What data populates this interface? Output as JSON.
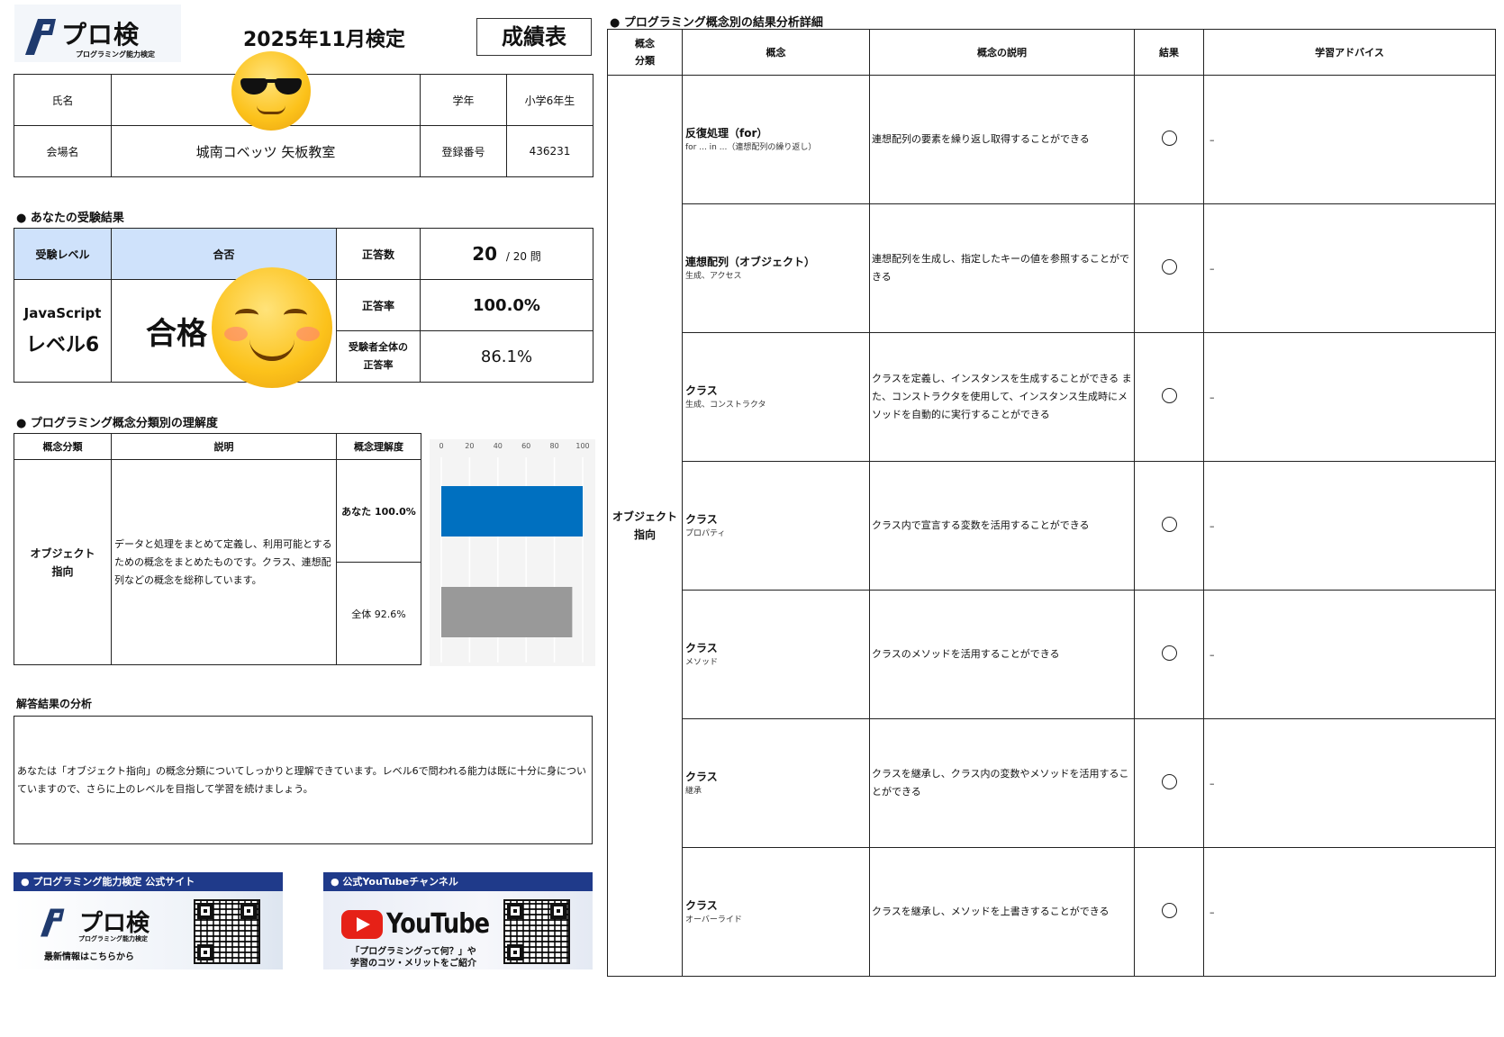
{
  "header": {
    "logo_text": "プロ検",
    "logo_sub": "プログラミング能力検定",
    "exam_title": "2025年11月検定",
    "report_title": "成績表"
  },
  "info": {
    "name_label": "氏名",
    "name_value": "",
    "grade_label": "学年",
    "grade_value": "小学6年生",
    "venue_label": "会場名",
    "venue_value": "城南コベッツ 矢板教室",
    "reg_label": "登録番号",
    "reg_value": "436231"
  },
  "result": {
    "section_title": "● あなたの受験結果",
    "level_header": "受験レベル",
    "pass_header": "合否",
    "correct_label": "正答数",
    "correct_value": "20",
    "correct_total": "/ 20 問",
    "level_line1": "JavaScript",
    "level_line2": "レベル6",
    "pass_value": "合格",
    "rate_label": "正答率",
    "rate_value": "100.0%",
    "overall_label_1": "受験者全体の",
    "overall_label_2": "正答率",
    "overall_value": "86.1%"
  },
  "understanding": {
    "section_title": "● プログラミング概念分類別の理解度",
    "col_category": "概念分類",
    "col_desc": "説明",
    "col_level": "概念理解度",
    "category_line1": "オブジェクト",
    "category_line2": "指向",
    "description": "データと処理をまとめて定義し、利用可能とするための概念をまとめたものです。クラス、連想配列などの概念を総称しています。",
    "you_label": "あなた 100.0%",
    "all_label": "全体 92.6%"
  },
  "chart_data": {
    "type": "bar",
    "orientation": "horizontal",
    "categories": [
      "あなた",
      "全体"
    ],
    "values": [
      100.0,
      92.6
    ],
    "colors": [
      "#0070c0",
      "#999999"
    ],
    "xlim": [
      0,
      100
    ],
    "ticks": [
      "0",
      "20",
      "40",
      "60",
      "80",
      "100"
    ],
    "grid": true
  },
  "analysis": {
    "title": "解答結果の分析",
    "text": "あなたは「オブジェクト指向」の概念分類についてしっかりと理解できています。レベル6で問われる能力は既に十分に身についていますので、さらに上のレベルを目指して学習を続けましょう。"
  },
  "banners": {
    "site_title": "● プログラミング能力検定 公式サイト",
    "site_logo": "プロ検",
    "site_logo_sub": "プログラミング能力検定",
    "site_caption": "最新情報はこちらから",
    "yt_title": "● 公式YouTubeチャンネル",
    "yt_logo": "YouTube",
    "yt_caption_1": "「プログラミングって何？」や",
    "yt_caption_2": "学習のコツ・メリットをご紹介"
  },
  "detail": {
    "section_title": "● プログラミング概念別の結果分析詳細",
    "col_category_1": "概念",
    "col_category_2": "分類",
    "col_concept": "概念",
    "col_desc": "概念の説明",
    "col_result": "結果",
    "col_advice": "学習アドバイス",
    "category_line1": "オブジェクト",
    "category_line2": "指向",
    "rows": [
      {
        "name": "反復処理（for）",
        "sub": "for ... in ...（連想配列の繰り返し）",
        "desc": "連想配列の要素を繰り返し取得することができる",
        "advice": "–"
      },
      {
        "name": "連想配列（オブジェクト）",
        "sub": "生成、アクセス",
        "desc": "連想配列を生成し、指定したキーの値を参照することができる",
        "advice": "–"
      },
      {
        "name": "クラス",
        "sub": "生成、コンストラクタ",
        "desc": "クラスを定義し、インスタンスを生成することができる また、コンストラクタを使用して、インスタンス生成時にメソッドを自動的に実行することができる",
        "advice": "–"
      },
      {
        "name": "クラス",
        "sub": "プロパティ",
        "desc": "クラス内で宣言する変数を活用することができる",
        "advice": "–"
      },
      {
        "name": "クラス",
        "sub": "メソッド",
        "desc": "クラスのメソッドを活用することができる",
        "advice": "–"
      },
      {
        "name": "クラス",
        "sub": "継承",
        "desc": "クラスを継承し、クラス内の変数やメソッドを活用することができる",
        "advice": "–"
      },
      {
        "name": "クラス",
        "sub": "オーバーライド",
        "desc": "クラスを継承し、メソッドを上書きすることができる",
        "advice": "–"
      }
    ]
  }
}
